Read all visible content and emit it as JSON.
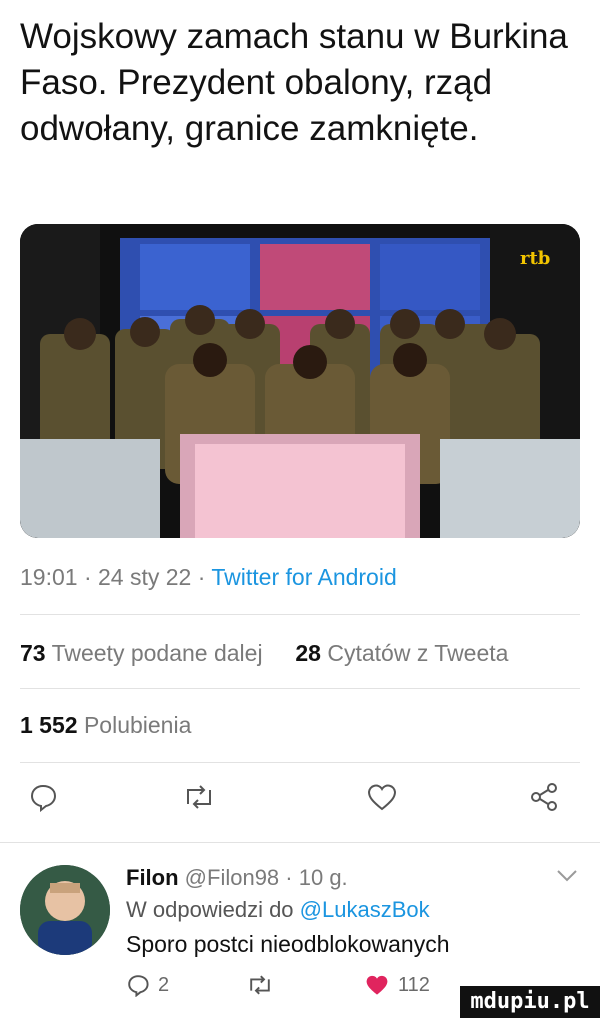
{
  "tweet": {
    "text": "Wojskowy zamach stanu w Burkina Faso. Prezydent obalony, rząd odwołany, granice zamknięte.",
    "media_logo": "rtb",
    "meta_time": "19:01",
    "meta_sep1": " · ",
    "meta_date": "24 sty 22",
    "meta_sep2": " · ",
    "meta_client": "Twitter for Android"
  },
  "stats": {
    "retweets_count": "73",
    "retweets_label": "Tweety podane dalej",
    "quotes_count": "28",
    "quotes_label": "Cytatów z Tweeta",
    "likes_count": "1 552",
    "likes_label": "Polubienia"
  },
  "actions": {
    "reply_icon": "comment-icon",
    "retweet_icon": "retweet-icon",
    "like_icon": "heart-icon",
    "share_icon": "share-icon"
  },
  "reply": {
    "name": "Filon",
    "handle": "@Filon98",
    "separator": " · ",
    "time": "10 g.",
    "replying_prefix": "W odpowiedzi do",
    "replying_to": "@LukaszBok",
    "text": "Sporo postci nieodblokowanych",
    "reply_count": "2",
    "like_count": "112",
    "like_color": "#e0245e"
  },
  "watermark": "mdupiu.pl",
  "colors": {
    "link": "#1b95e0",
    "muted": "#7a7a7a",
    "divider": "#e2e2e2"
  }
}
